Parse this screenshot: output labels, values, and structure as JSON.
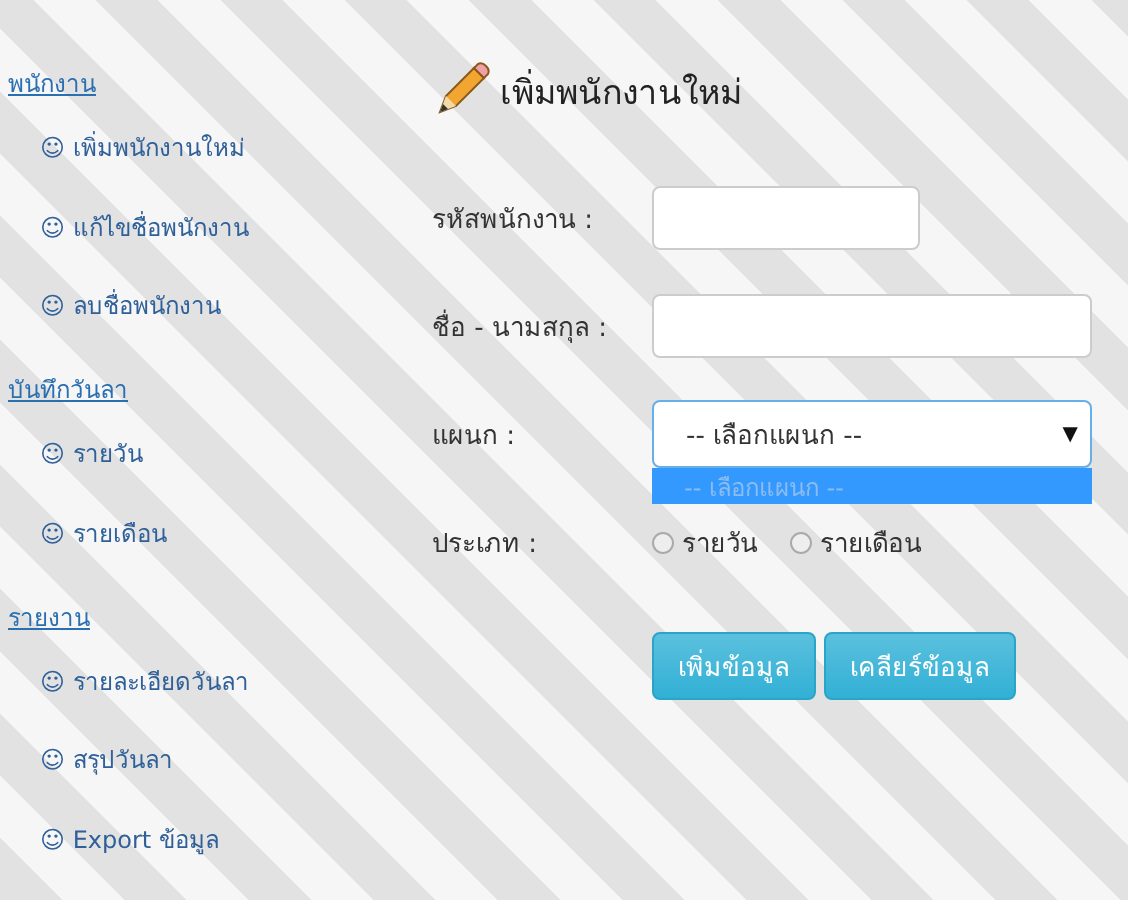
{
  "sidebar": {
    "sections": [
      {
        "title": "พนักงาน",
        "items": [
          {
            "icon": "☺",
            "label": "เพิ่มพนักงานใหม่"
          },
          {
            "icon": "☺",
            "label": "แก้ไขชื่อพนักงาน"
          },
          {
            "icon": "☺",
            "label": "ลบชื่อพนักงาน"
          }
        ]
      },
      {
        "title": "บันทึกวันลา",
        "items": [
          {
            "icon": "☺",
            "label": "รายวัน"
          },
          {
            "icon": "☺",
            "label": "รายเดือน"
          }
        ]
      },
      {
        "title": "รายงาน",
        "items": [
          {
            "icon": "☺",
            "label": "รายละเอียดวันลา"
          },
          {
            "icon": "☺",
            "label": "สรุปวันลา"
          },
          {
            "icon": "☺",
            "label": "Export ข้อมูล"
          }
        ]
      }
    ]
  },
  "form": {
    "title": "เพิ่มพนักงานใหม่",
    "fields": [
      {
        "kind": "text",
        "label": "รหัสพนักงาน :",
        "wide": false
      },
      {
        "kind": "text",
        "label": "ชื่อ - นามสกุล :",
        "wide": true
      },
      {
        "kind": "select",
        "label": "แผนก :",
        "value": "-- เลือกแผนก --",
        "arrow": "▼",
        "options": [
          {
            "label": "-- เลือกแผนก --",
            "selected": true
          }
        ]
      },
      {
        "kind": "radio",
        "label": "ประเภท :",
        "options": [
          {
            "label": "รายวัน",
            "selected": false
          },
          {
            "label": "รายเดือน",
            "selected": false
          }
        ]
      }
    ],
    "buttons": [
      "เพิ่มข้อมูล",
      "เคลียร์ข้อมูล"
    ]
  }
}
